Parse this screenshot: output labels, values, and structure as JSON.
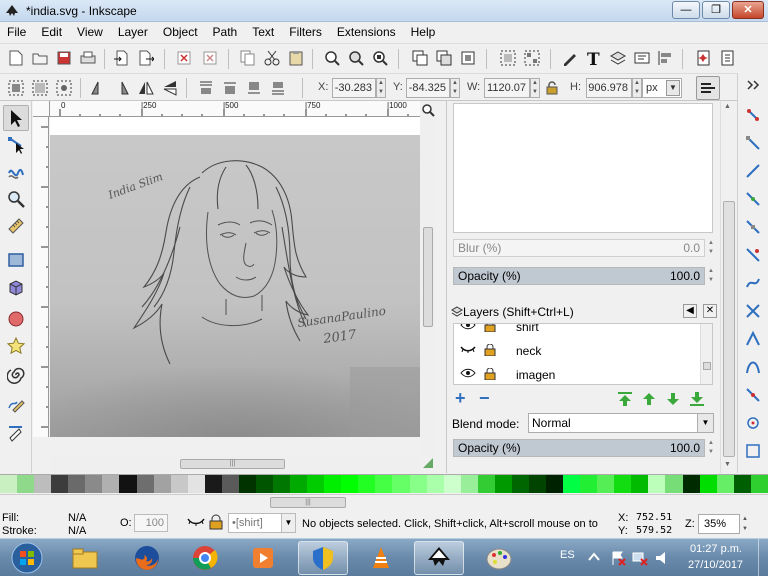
{
  "window": {
    "title": "*india.svg - Inkscape",
    "minimize_label": "—",
    "maximize_label": "❐",
    "close_label": "✕"
  },
  "menu": [
    "File",
    "Edit",
    "View",
    "Layer",
    "Object",
    "Path",
    "Text",
    "Filters",
    "Extensions",
    "Help"
  ],
  "select_toolbar": {
    "x_label": "X:",
    "x_value": "-30.283",
    "y_label": "Y:",
    "y_value": "-84.325",
    "w_label": "W:",
    "w_value": "1120.07",
    "h_label": "H:",
    "h_value": "906.978",
    "unit": "px"
  },
  "ruler": {
    "h_labels": [
      "0",
      "|250",
      "|500",
      "|750",
      "|1000"
    ]
  },
  "canvas": {
    "signature_title": "India Slim",
    "signature_artist": "SusanaPaulino",
    "signature_year": "2017"
  },
  "dialog": {
    "blur_label": "Blur (%)",
    "blur_value": "0.0",
    "opacity_label": "Opacity (%)",
    "opacity_value": "100.0",
    "layers_title": "Layers (Shift+Ctrl+L)",
    "layers": [
      {
        "name": "shirt",
        "visible": true,
        "locked": true
      },
      {
        "name": "neck",
        "visible": false,
        "locked": true
      },
      {
        "name": "imagen",
        "visible": true,
        "locked": true
      }
    ],
    "blend_label": "Blend mode:",
    "blend_value": "Normal",
    "layer_opacity_label": "Opacity (%)",
    "layer_opacity_value": "100.0"
  },
  "palette": [
    "#c9f0c0",
    "#8fd98a",
    "#bdbdbd",
    "#3c3c3c",
    "#6a6a6a",
    "#8a8a8a",
    "#b0b0b0",
    "#121212",
    "#6e6e6e",
    "#a2a2a2",
    "#c8c8c8",
    "#e3e3e3",
    "#1a1a1a",
    "#5a5a5a",
    "#003300",
    "#005500",
    "#007700",
    "#00aa00",
    "#00cc00",
    "#00ee00",
    "#00ff00",
    "#22ff22",
    "#44ff44",
    "#66ff66",
    "#88ff88",
    "#aaffaa",
    "#ccffcc",
    "#99ee99",
    "#33cc33",
    "#009900",
    "#006600",
    "#004400",
    "#002200",
    "#00ff44",
    "#22ee33",
    "#55ee55",
    "#11dd11",
    "#00bb00",
    "#bbffbb",
    "#77dd77",
    "#002a00",
    "#00dd00",
    "#66ee66",
    "#005f00",
    "#2fcf2f"
  ],
  "status": {
    "fill_label": "Fill:",
    "fill_value": "N/A",
    "stroke_label": "Stroke:",
    "stroke_value": "N/A",
    "o_label": "O:",
    "o_value": "100",
    "layer_name": "•[shirt]",
    "message": "No objects selected. Click, Shift+click, Alt+scroll mouse on to",
    "x_label": "X:",
    "x_value": "752.51",
    "y_label": "Y:",
    "y_value": "579.52",
    "z_label": "Z:",
    "zoom": "35%"
  },
  "taskbar": {
    "lang": "ES",
    "time": "01:27 p.m.",
    "date": "27/10/2017"
  },
  "colors": {
    "accent_green": "#3aa83a",
    "layer_icons_blue": "#2f6fbf",
    "taskbar": "#6a8aab"
  }
}
